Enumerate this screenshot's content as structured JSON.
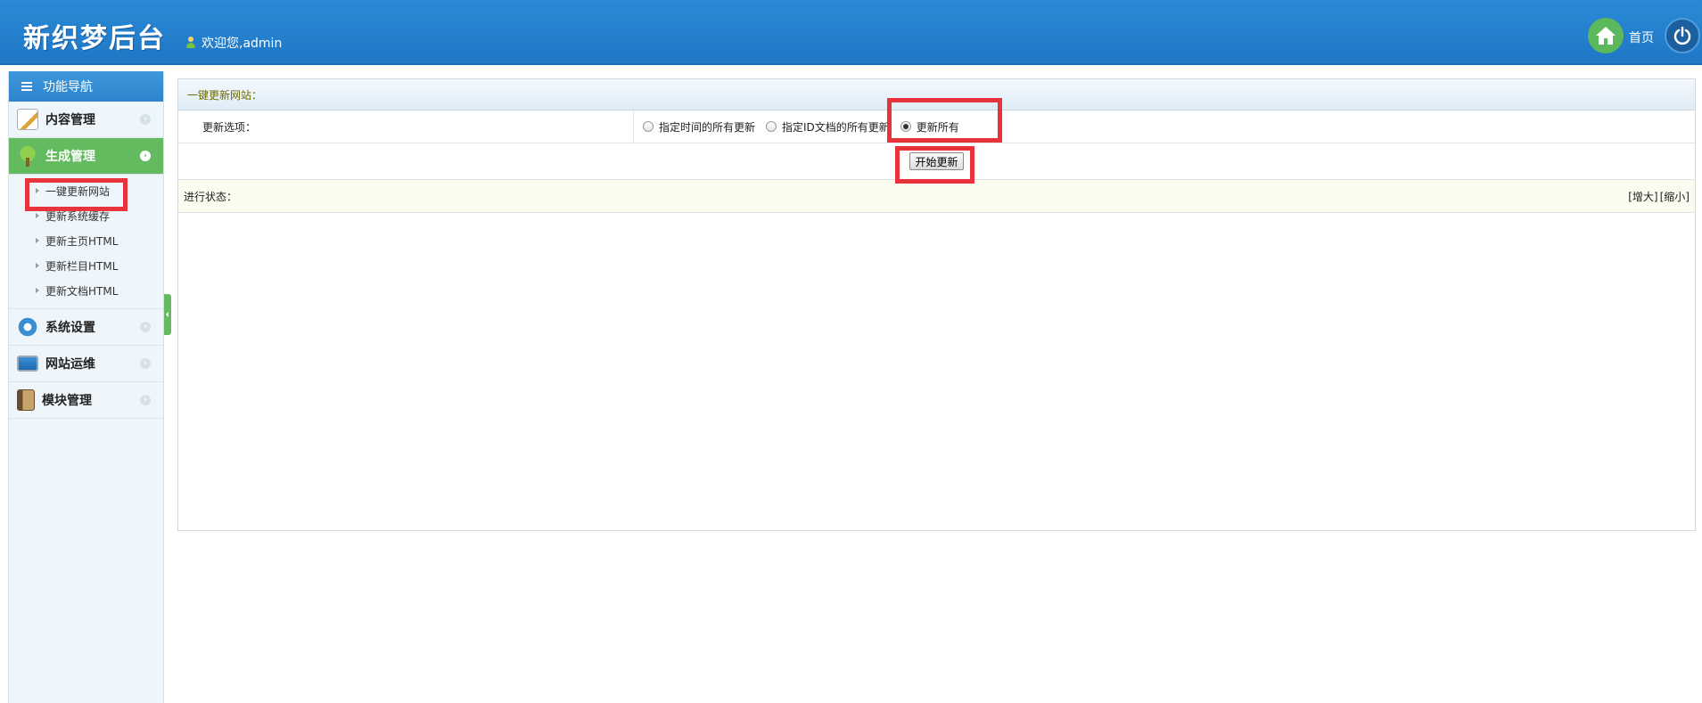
{
  "header": {
    "logo": "新织梦后台",
    "welcome": "欢迎您,admin",
    "home_label": "首页"
  },
  "sidebar": {
    "title": "功能导航",
    "groups": [
      {
        "label": "内容管理",
        "icon": "edit-icon"
      },
      {
        "label": "生成管理",
        "icon": "tree-icon",
        "active": true
      },
      {
        "label": "系统设置",
        "icon": "gear-icon"
      },
      {
        "label": "网站运维",
        "icon": "monitor-icon"
      },
      {
        "label": "模块管理",
        "icon": "book-icon"
      }
    ],
    "sub_items": [
      "一键更新网站",
      "更新系统缓存",
      "更新主页HTML",
      "更新栏目HTML",
      "更新文档HTML"
    ]
  },
  "panel": {
    "title": "一键更新网站：",
    "option_label": "更新选项：",
    "options": [
      "指定时间的所有更新",
      "指定ID文档的所有更新",
      "更新所有"
    ],
    "selected_option": "更新所有",
    "start_button": "开始更新",
    "status_label": "进行状态：",
    "enlarge": "[增大]",
    "shrink": "[缩小]"
  },
  "colors": {
    "header_blue": "#2a8ad6",
    "active_green": "#64bb5f",
    "highlight_red": "#e8323c"
  }
}
